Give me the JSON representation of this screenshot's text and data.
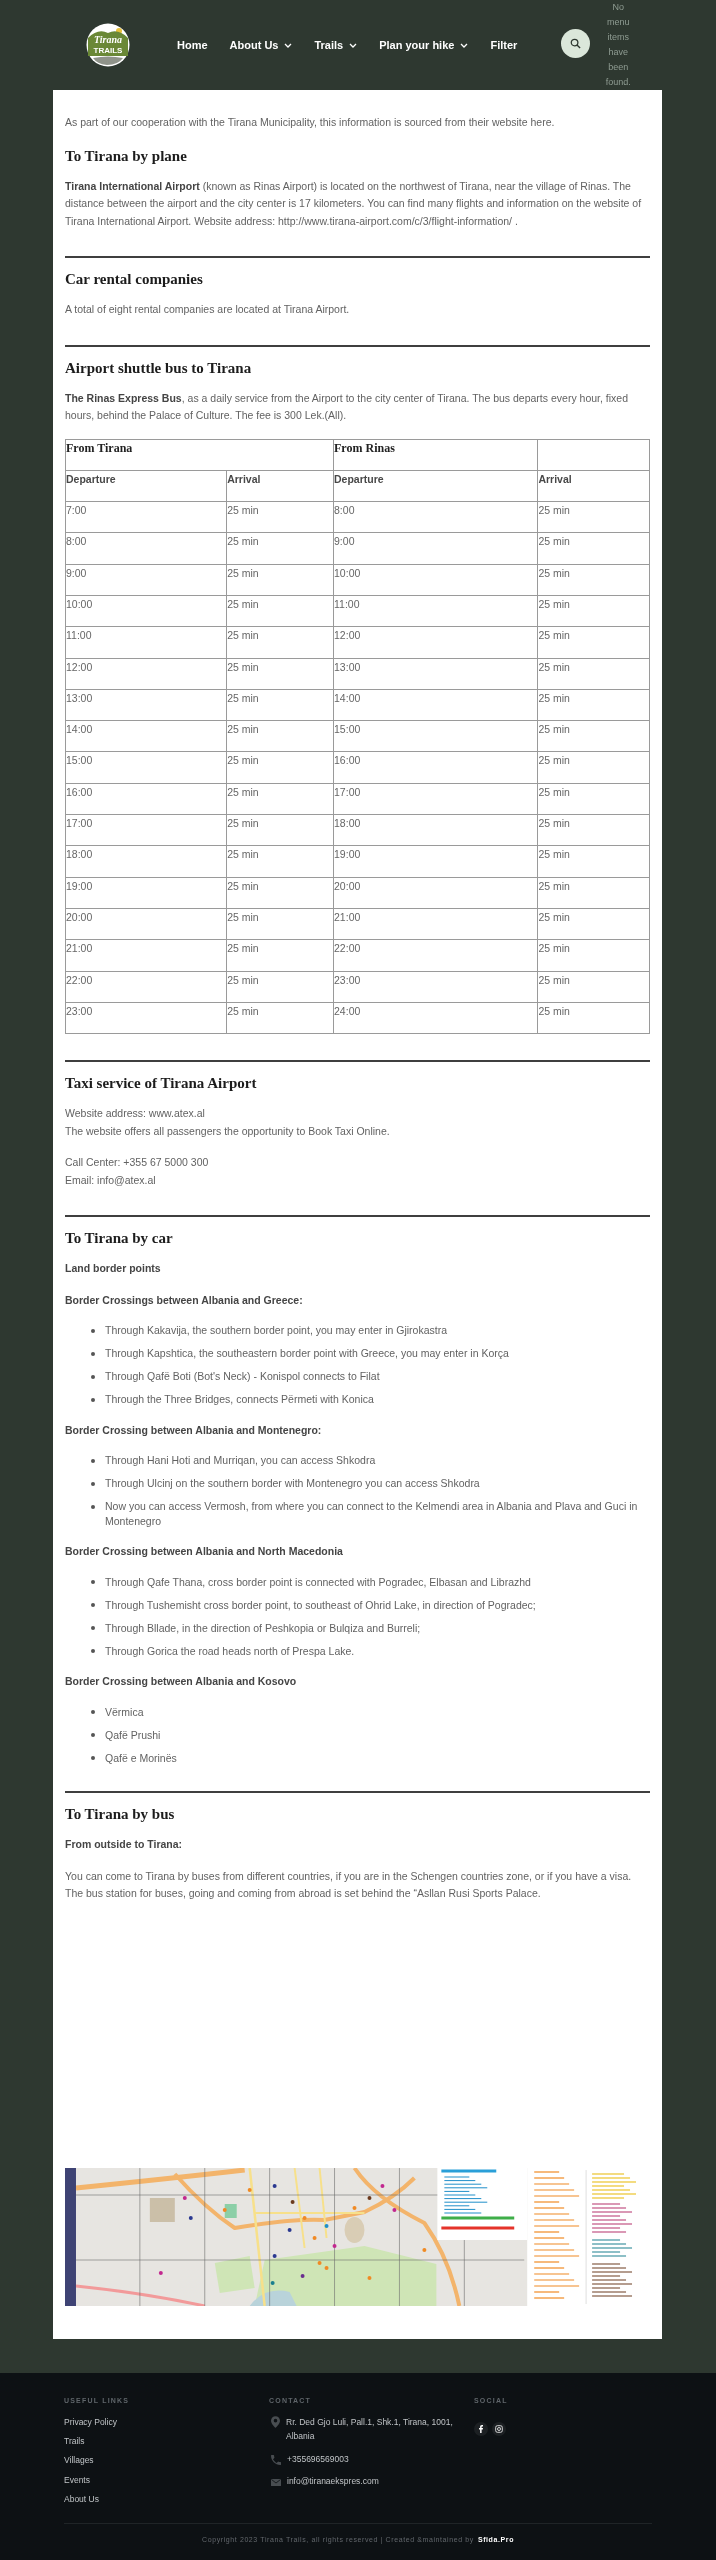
{
  "header": {
    "logo": {
      "title": "Tirana",
      "subtitle": "TRAILS"
    },
    "nav": [
      {
        "label": "Home",
        "has_submenu": false
      },
      {
        "label": "About Us",
        "has_submenu": true
      },
      {
        "label": "Trails",
        "has_submenu": true
      },
      {
        "label": "Plan your hike",
        "has_submenu": true
      },
      {
        "label": "Filter",
        "has_submenu": false
      }
    ],
    "empty_menu_notice": "No menu items have been found."
  },
  "content": {
    "intro": "As part of our cooperation with the Tirana Municipality, this information is sourced from their website here.",
    "sections": [
      {
        "title": "To Tirana by plane",
        "blocks": [
          {
            "kind": "paragraph",
            "text": "**Tirana International Airport** (known as Rinas Airport) is located on the northwest of Tirana, near the village of Rinas. The distance between the airport and the city center is 17 kilometers. You can find many flights and information on the website of Tirana International Airport. Website address: http://www.tirana-airport.com/c/3/flight-information/ ."
          }
        ]
      },
      {
        "title": "Car rental companies",
        "blocks": [
          {
            "kind": "paragraph",
            "text": "A total of eight rental companies are located at Tirana Airport."
          }
        ]
      },
      {
        "title": "Airport shuttle bus to Tirana",
        "blocks": [
          {
            "kind": "paragraph",
            "text": "**The Rinas Express Bus**, as a daily service from the Airport to the city center of Tirana. The bus departs every hour, fixed hours, behind the Palace of Culture. The fee is 300 Lek.(All)."
          },
          {
            "kind": "table",
            "group_headers": [
              {
                "text": "From Tirana",
                "double_width": true
              },
              {
                "text": "From Rinas",
                "double_width": false
              }
            ],
            "columns": [
              "Departure",
              "Arrival",
              "Departure",
              "Arrival"
            ],
            "rows": [
              [
                "7:00",
                "25 min",
                "8:00",
                "25 min"
              ],
              [
                "8:00",
                "25 min",
                "9:00",
                "25 min"
              ],
              [
                "9:00",
                "25 min",
                "10:00",
                "25 min"
              ],
              [
                "10:00",
                "25 min",
                "11:00",
                "25 min"
              ],
              [
                "11:00",
                "25 min",
                "12:00",
                "25 min"
              ],
              [
                "12:00",
                "25 min",
                "13:00",
                "25 min"
              ],
              [
                "13:00",
                "25 min",
                "14:00",
                "25 min"
              ],
              [
                "14:00",
                "25 min",
                "15:00",
                "25 min"
              ],
              [
                "15:00",
                "25 min",
                "16:00",
                "25 min"
              ],
              [
                "16:00",
                "25 min",
                "17:00",
                "25 min"
              ],
              [
                "17:00",
                "25 min",
                "18:00",
                "25 min"
              ],
              [
                "18:00",
                "25 min",
                "19:00",
                "25 min"
              ],
              [
                "19:00",
                "25 min",
                "20:00",
                "25 min"
              ],
              [
                "20:00",
                "25 min",
                "21:00",
                "25 min"
              ],
              [
                "21:00",
                "25 min",
                "22:00",
                "25 min"
              ],
              [
                "22:00",
                "25 min",
                "23:00",
                "25 min"
              ],
              [
                "23:00",
                "25 min",
                "24:00",
                "25 min"
              ]
            ]
          }
        ]
      },
      {
        "title": "Taxi service of Tirana Airport",
        "blocks": [
          {
            "kind": "lines",
            "lines": [
              "Website address: www.atex.al",
              "The website offers all passengers the opportunity to Book Taxi Online."
            ]
          },
          {
            "kind": "lines",
            "lines": [
              "Call Center: +355 67 5000 300",
              "Email: info@atex.al"
            ]
          }
        ]
      },
      {
        "title": "To Tirana by car",
        "blocks": [
          {
            "kind": "subheading",
            "text": "Land border points"
          },
          {
            "kind": "subheading",
            "text": "Border Crossings between Albania and Greece:"
          },
          {
            "kind": "list",
            "items": [
              "Through Kakavija, the southern border point, you may enter in Gjirokastra",
              "Through Kapshtica, the southeastern border point with Greece, you may enter in Korça",
              "Through Qafë Boti (Bot's Neck) - Konispol connects to Filat",
              "Through the Three Bridges, connects Përmeti with Konica"
            ]
          },
          {
            "kind": "subheading",
            "text": "Border Crossing between Albania and Montenegro:"
          },
          {
            "kind": "list",
            "items": [
              "Through Hani Hoti and Murriqan, you can access Shkodra",
              "Through Ulcinj on the southern border with Montenegro you can access Shkodra",
              "Now you can access Vermosh, from where you can connect to the Kelmendi area in Albania and Plava and Guci in Montenegro"
            ]
          },
          {
            "kind": "subheading",
            "text": "Border Crossing between Albania and North Macedonia"
          },
          {
            "kind": "list",
            "items": [
              "Through Qafe Thana, cross border point is connected with Pogradec, Elbasan and Librazhd",
              "Through Tushemisht cross border point, to southeast of Ohrid Lake, in direction of Pogradec;",
              "Through Bllade, in the direction of Peshkopia or Bulqiza and Burreli;",
              "Through Gorica the road heads north of Prespa Lake."
            ]
          },
          {
            "kind": "subheading",
            "text": "Border Crossing between Albania and Kosovo"
          },
          {
            "kind": "list",
            "items": [
              "Vërmica",
              "Qafë Prushi",
              "Qafë e Morinës"
            ]
          }
        ]
      },
      {
        "title": "To Tirana by bus",
        "blocks": [
          {
            "kind": "subheading",
            "text": "From outside to Tirana:"
          },
          {
            "kind": "paragraph",
            "text": "You can come to Tirana by buses from different countries, if you are in the Schengen countries zone, or if you have a visa. The bus station for buses, going and coming from abroad is set behind the “Asllan Rusi Sports Palace."
          }
        ]
      }
    ]
  },
  "footer": {
    "useful_links": {
      "title": "USEFUL LINKS",
      "links": [
        "Privacy Policy",
        "Trails",
        "Villages",
        "Events",
        "About Us"
      ]
    },
    "contact": {
      "title": "CONTACT",
      "items": [
        {
          "kind": "address",
          "text": "Rr. Ded Gjo Luli, Pall.1, Shk.1, Tirana, 1001, Albania"
        },
        {
          "kind": "phone",
          "text": "+355696569003"
        },
        {
          "kind": "email",
          "text": "info@tiranaekspres.com"
        }
      ]
    },
    "social": {
      "title": "SOCIAL",
      "links": [
        {
          "kind": "facebook"
        },
        {
          "kind": "instagram"
        }
      ]
    },
    "copyright": "Copyright 2023 Tirana Trails, all rights reserved | Created &maintained by",
    "credit_link": "Sfida.Pro"
  }
}
